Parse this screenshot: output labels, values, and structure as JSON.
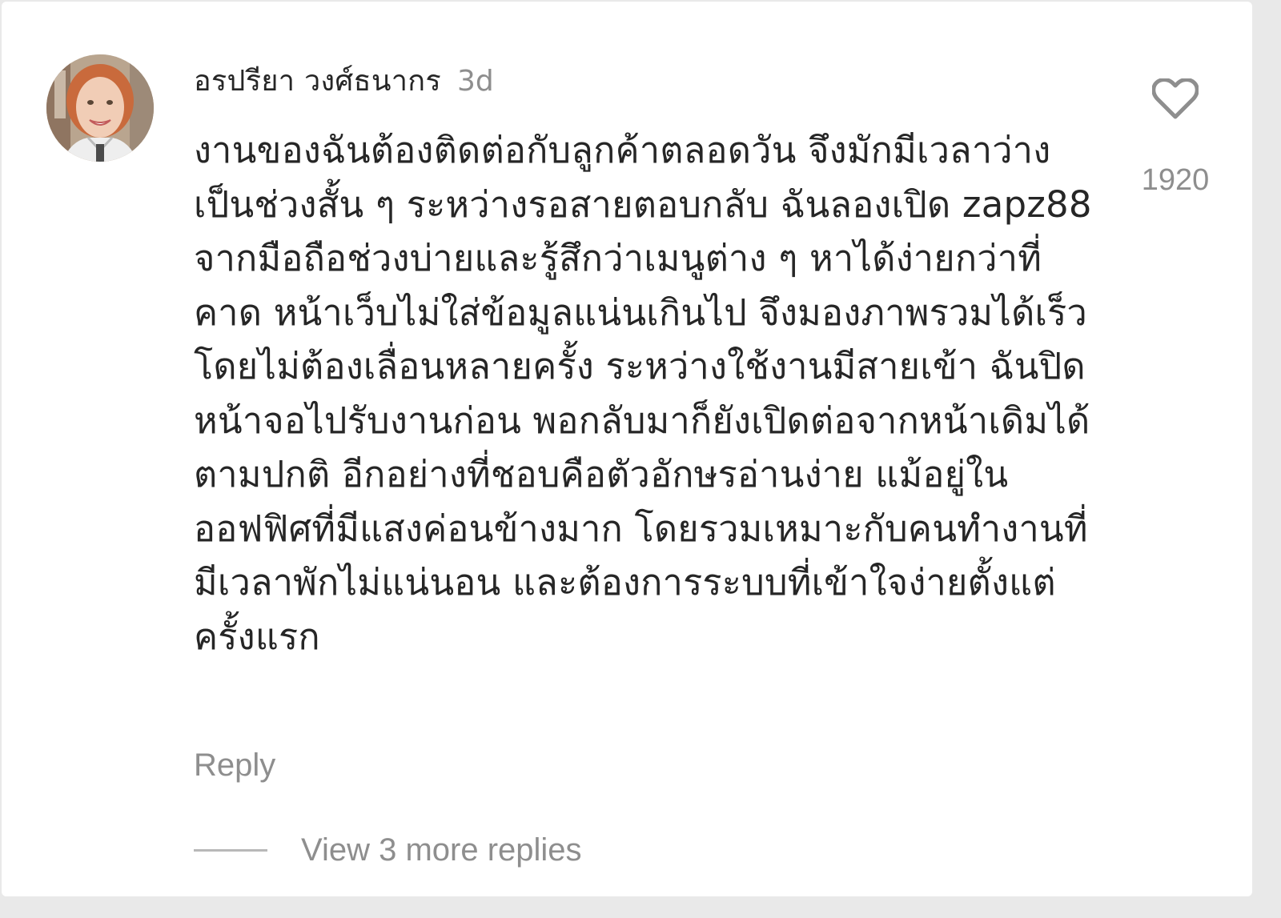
{
  "comment": {
    "username": "อรปรียา วงศ์ธนากร",
    "timestamp": "3d",
    "text": "งานของฉันต้องติดต่อกับลูกค้าตลอดวัน จึงมักมีเวลาว่างเป็นช่วงสั้น ๆ ระหว่างรอสายตอบกลับ ฉันลองเปิด zapz88 จากมือถือช่วงบ่ายและรู้สึกว่าเมนูต่าง ๆ หาได้ง่ายกว่าที่คาด หน้าเว็บไม่ใส่ข้อมูลแน่นเกินไป จึงมองภาพรวมได้เร็วโดยไม่ต้องเลื่อนหลายครั้ง ระหว่างใช้งานมีสายเข้า ฉันปิดหน้าจอไปรับงานก่อน พอกลับมาก็ยังเปิดต่อจากหน้าเดิมได้ตามปกติ อีกอย่างที่ชอบคือตัวอักษรอ่านง่าย แม้อยู่ในออฟฟิศที่มีแสงค่อนข้างมาก โดยรวมเหมาะกับคนทำงานที่มีเวลาพักไม่แน่นอน และต้องการระบบที่เข้าใจง่ายตั้งแต่ครั้งแรก",
    "reply_label": "Reply",
    "view_replies_label": "View 3 more replies",
    "like_count": "1920"
  },
  "icons": {
    "avatar": "user-avatar-photo",
    "like": "heart-outline-icon"
  },
  "colors": {
    "text_primary": "#262626",
    "text_secondary": "#8e8e8e",
    "background": "#ffffff"
  }
}
